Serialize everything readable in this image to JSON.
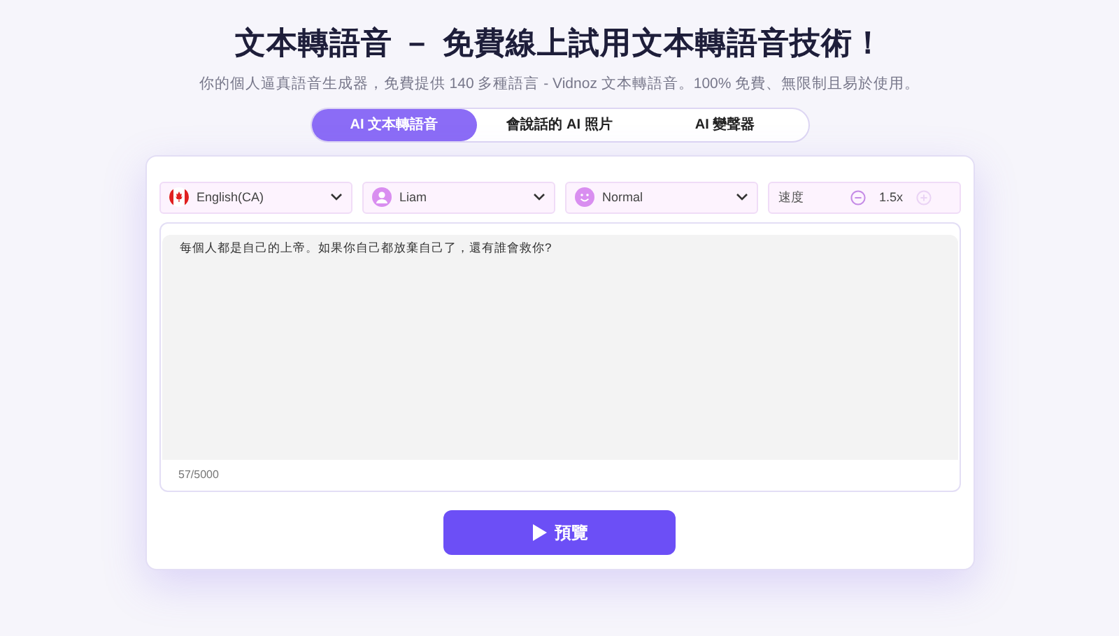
{
  "heading": "文本轉語音 － 免費線上試用文本轉語音技術！",
  "subtitle": "你的個人逼真語音生成器，免費提供 140 多種語言 - Vidnoz 文本轉語音。100% 免費、無限制且易於使用。",
  "tabs": [
    {
      "label": "AI 文本轉語音",
      "selected": true
    },
    {
      "label": "會說話的 AI 照片",
      "selected": false
    },
    {
      "label": "AI 變聲器",
      "selected": false
    }
  ],
  "selectors": [
    {
      "kind": "language",
      "value": "English(CA)"
    },
    {
      "kind": "voice",
      "value": "Liam"
    },
    {
      "kind": "emotion",
      "value": "Normal"
    }
  ],
  "speed": {
    "label": "速度",
    "value": "1.5x"
  },
  "text_input": {
    "value": "每個人都是自己的上帝。如果你自己都放棄自己了，還有誰會救你?",
    "count": "57/5000"
  },
  "preview_button": "預覽"
}
